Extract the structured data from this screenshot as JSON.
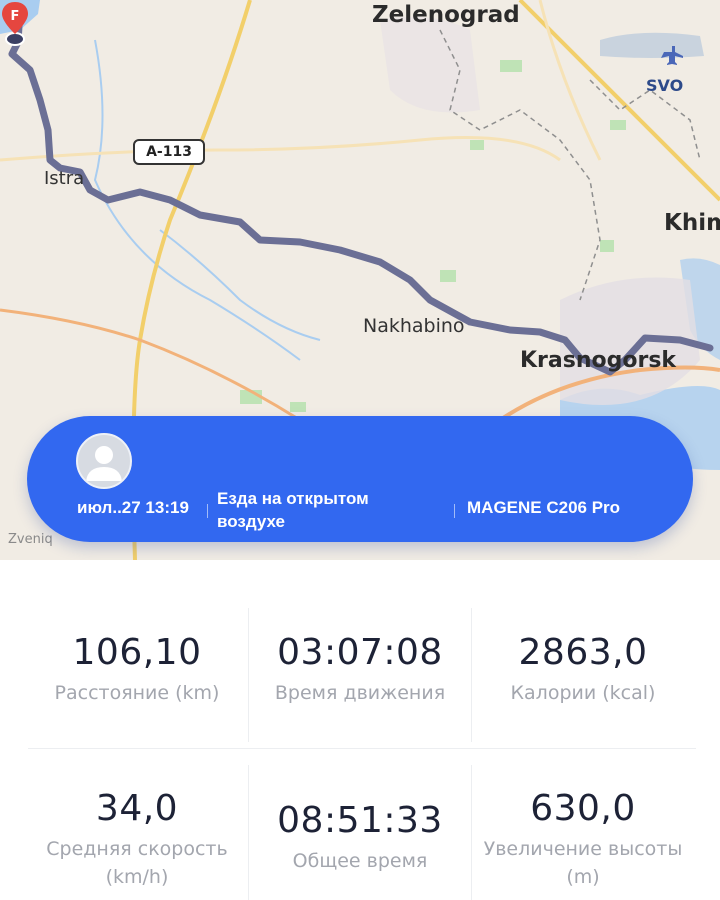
{
  "map": {
    "labels": {
      "zelenograd": "Zelenograd",
      "istra": "Istra",
      "nakhabino": "Nakhabino",
      "krasnogorsk": "Krasnogorsk",
      "khimki": "Khim",
      "zvenigorod": "Zveniq",
      "svo": "SVO"
    },
    "road_shield": "A-113",
    "finish_marker": "F",
    "route_color": "#6b6f95"
  },
  "ride_card": {
    "date": "июл..27 13:19",
    "activity": "Езда на открытом воздухе",
    "device": "MAGENE C206 Pro",
    "background_color": "#3268f0"
  },
  "stats": [
    {
      "value": "106,10",
      "label": "Расстояние (km)"
    },
    {
      "value": "03:07:08",
      "label": "Время движения"
    },
    {
      "value": "2863,0",
      "label": "Калории (kcal)"
    },
    {
      "value": "34,0",
      "label": "Средняя скорость (km/h)"
    },
    {
      "value": "08:51:33",
      "label": "Общее время"
    },
    {
      "value": "630,0",
      "label": "Увеличение высоты (m)"
    }
  ]
}
